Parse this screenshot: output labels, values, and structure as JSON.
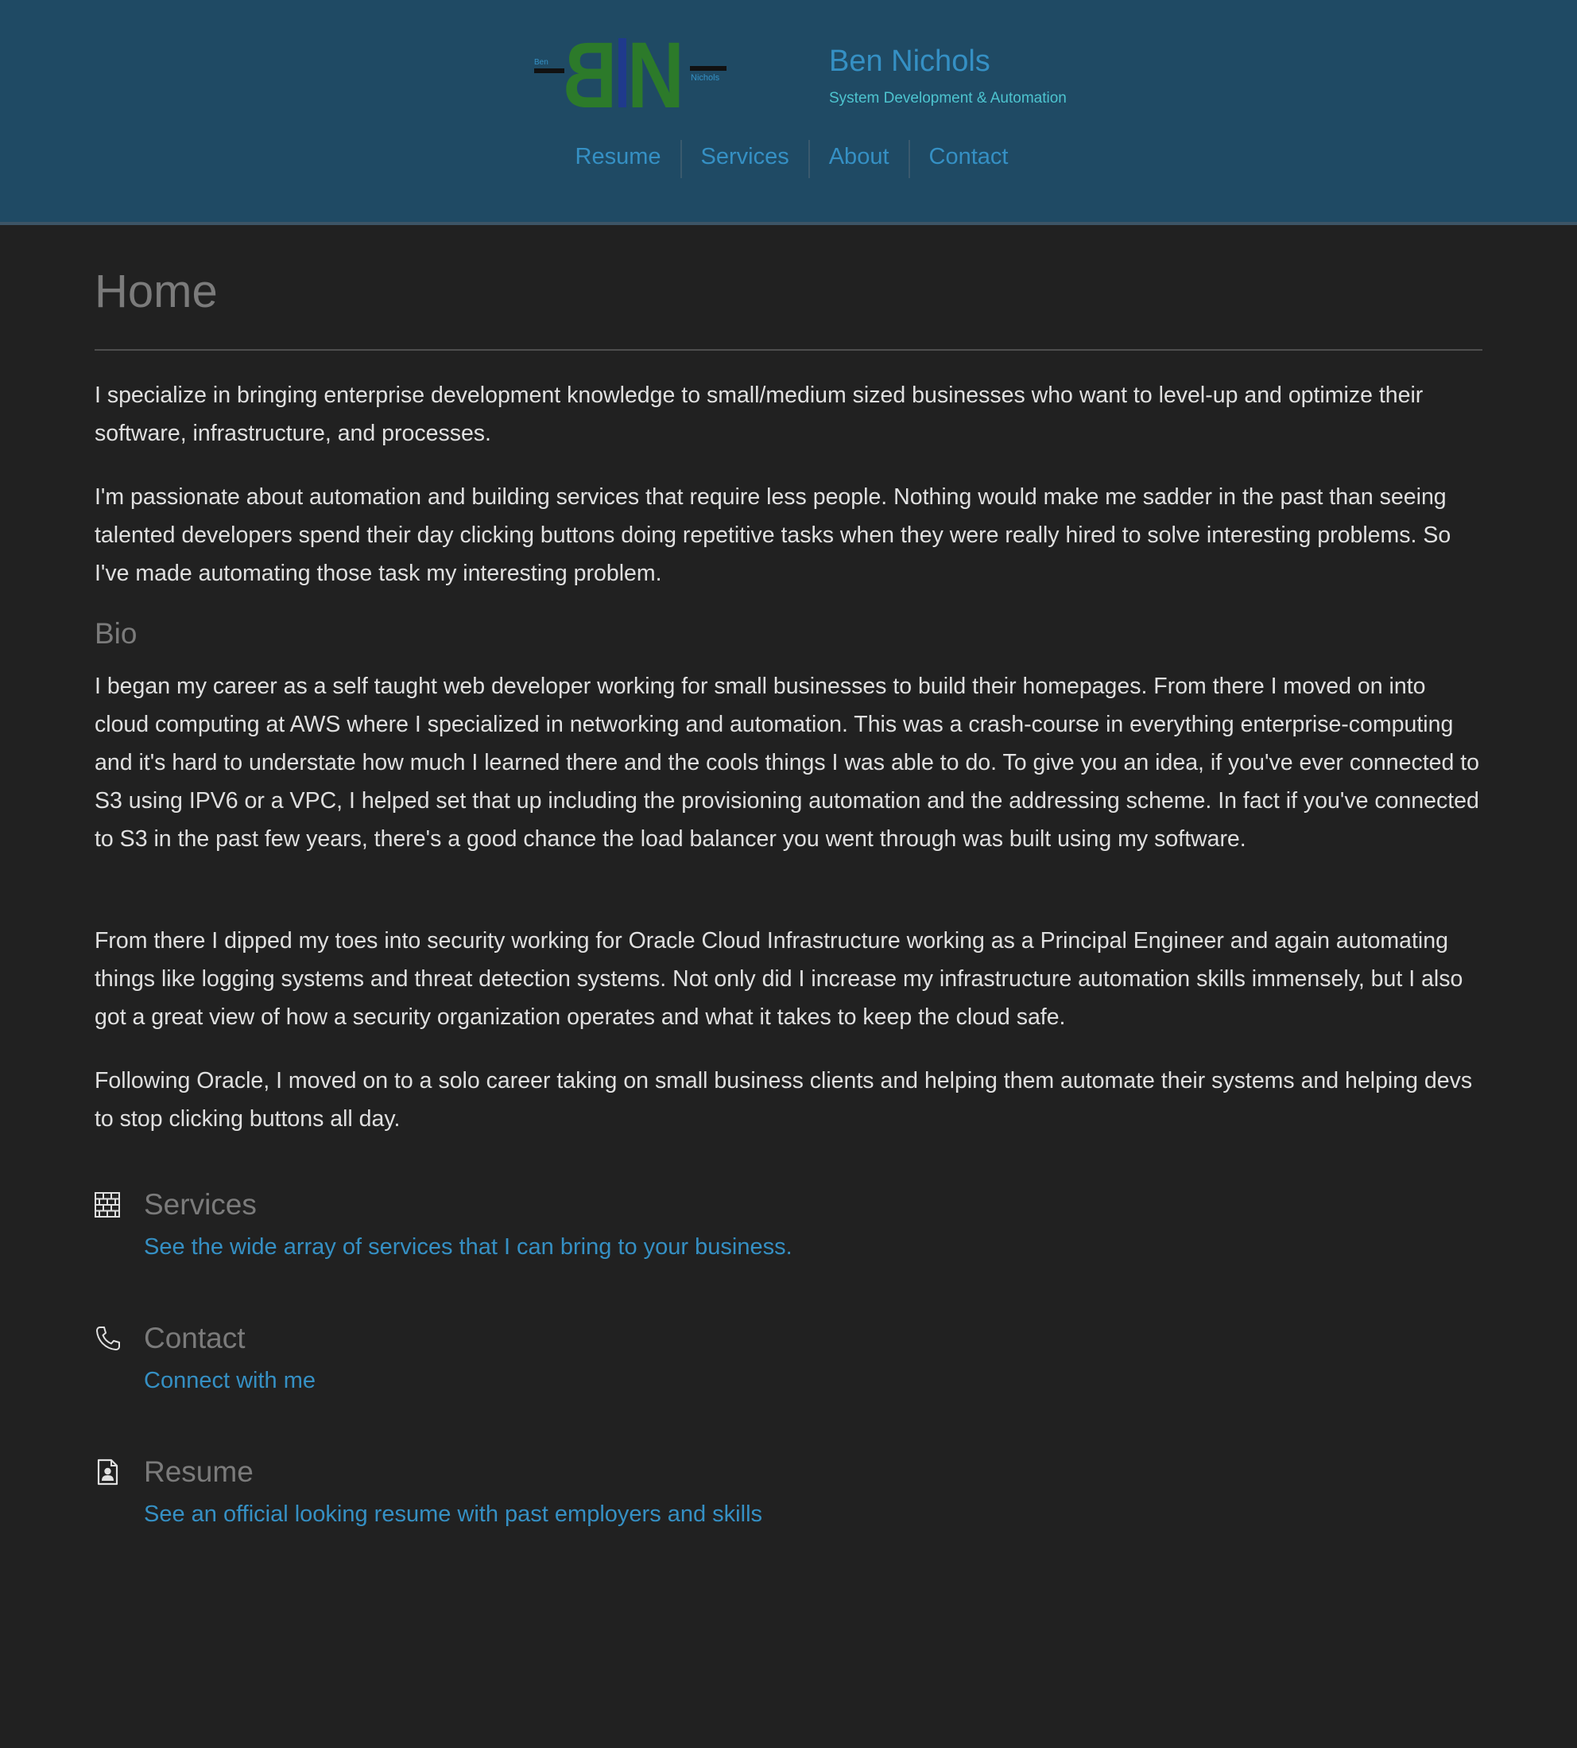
{
  "header": {
    "logo": {
      "letters": "BN",
      "small_left": "Ben",
      "small_right": "Nichols"
    },
    "site_title": "Ben Nichols",
    "site_subtitle": "System Development & Automation",
    "nav": [
      "Resume",
      "Services",
      "About",
      "Contact"
    ]
  },
  "main": {
    "page_title": "Home",
    "intro_paragraphs": [
      "I specialize in bringing enterprise development knowledge to small/medium sized businesses who want to level-up and optimize their software, infrastructure, and processes.",
      "I'm passionate about automation and building services that require less people. Nothing would make me sadder in the past than seeing talented developers spend their day clicking buttons doing repetitive tasks when they were really hired to solve interesting problems. So I've made automating those task my interesting problem."
    ],
    "bio_heading": "Bio",
    "bio_paragraphs": [
      "I began my career as a self taught web developer working for small businesses to build their homepages. From there I moved on into cloud computing at AWS where I specialized in networking and automation. This was a crash-course in everything enterprise-computing and it's hard to understate how much I learned there and the cools things I was able to do. To give you an idea, if you've ever connected to S3 using IPV6 or a VPC, I helped set that up including the provisioning automation and the addressing scheme. In fact if you've connected to S3 in the past few years, there's a good chance the load balancer you went through was built using my software.",
      "From there I dipped my toes into security working for Oracle Cloud Infrastructure working as a Principal Engineer and again automating things like logging systems and threat detection systems. Not only did I increase my infrastructure automation skills immensely, but I also got a great view of how a security organization operates and what it takes to keep the cloud safe.",
      "Following Oracle, I moved on to a solo career taking on small business clients and helping them automate their systems and helping devs to stop clicking buttons all day."
    ],
    "cards": [
      {
        "icon": "brick-wall-icon",
        "title": "Services",
        "link": "See the wide array of services that I can bring to your business."
      },
      {
        "icon": "phone-icon",
        "title": "Contact",
        "link": "Connect with me"
      },
      {
        "icon": "resume-document-icon",
        "title": "Resume",
        "link": "See an official looking resume with past employers and skills"
      }
    ]
  },
  "colors": {
    "header_bg": "#1f4a64",
    "page_bg": "#212121",
    "link": "#3590c4",
    "subtitle": "#4dc4cf",
    "logo_green": "#2c7a2a",
    "logo_blue": "#1f3a8c",
    "body_text": "#e0e0e0",
    "heading_gray": "#7b7b7b"
  }
}
